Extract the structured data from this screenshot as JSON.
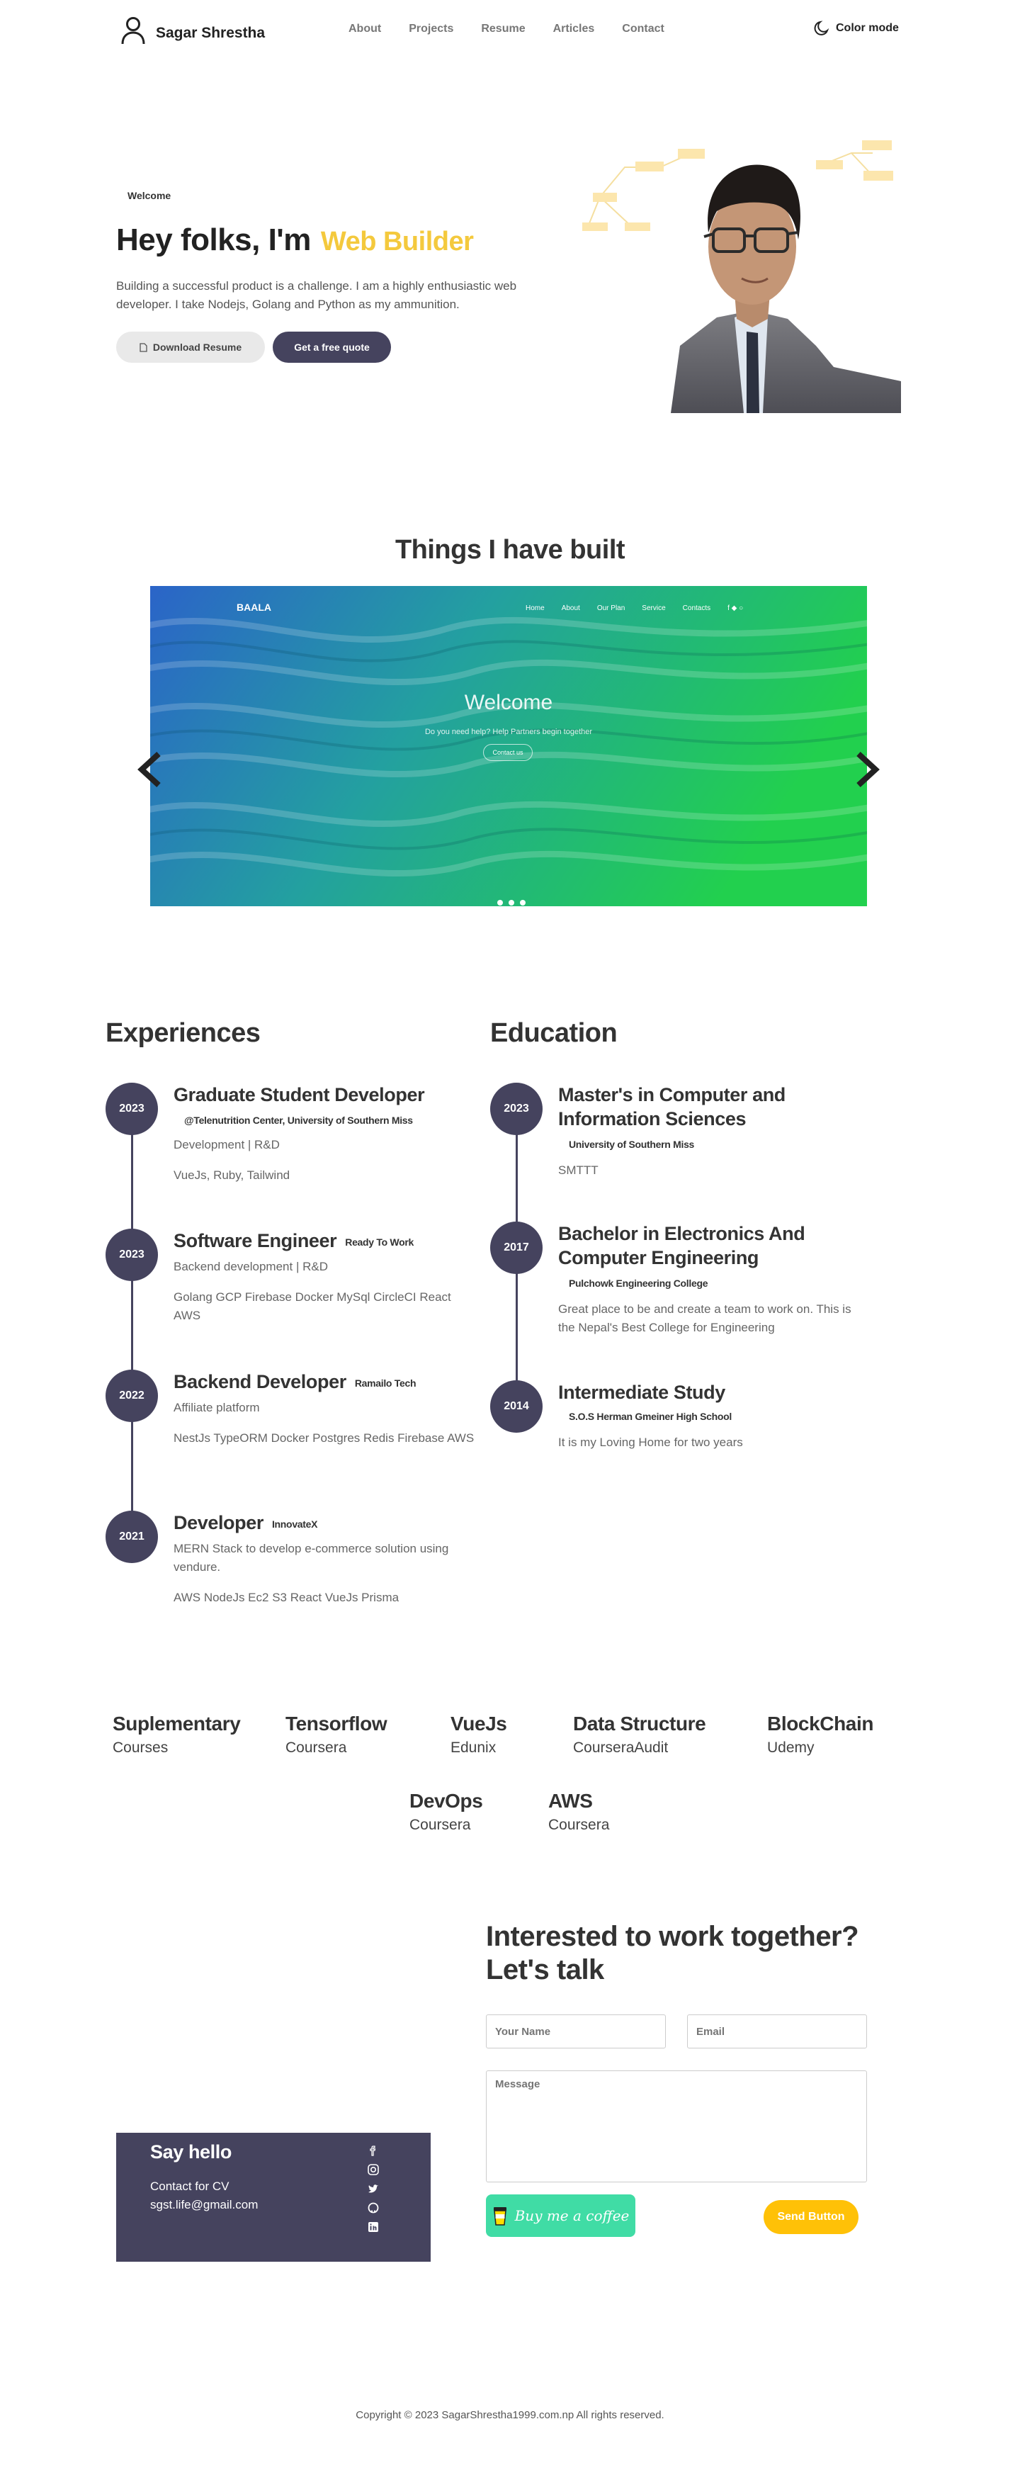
{
  "header": {
    "brand_name": "Sagar Shrestha",
    "nav": [
      "About",
      "Projects",
      "Resume",
      "Articles",
      "Contact"
    ],
    "color_mode_label": "Color mode"
  },
  "hero": {
    "welcome": "Welcome",
    "title": "Hey folks, I'm",
    "title_accent": "Web Builder",
    "description": "Building a successful product is a challenge. I am a highly enthusiastic web developer. I take Nodejs, Golang and Python as my ammunition.",
    "resume_button": "Download Resume",
    "quote_button": "Get a free quote",
    "accent_color": "#f4c93d"
  },
  "projects": {
    "title": "Things I have built",
    "slide": {
      "logo": "BAALA",
      "nav": [
        "Home",
        "About",
        "Our Plan",
        "Service",
        "Contacts"
      ],
      "heading": "Welcome",
      "subtitle": "Do you need help? Help Partners begin together",
      "button": "Contact us"
    }
  },
  "experiences": {
    "title": "Experiences",
    "items": [
      {
        "year": "2023",
        "role": "Graduate Student Developer",
        "org": "@Telenutrition Center, University of Southern Miss",
        "summary": "Development | R&D",
        "stack": "VueJs, Ruby, Tailwind"
      },
      {
        "year": "2023",
        "role": "Software Engineer",
        "org": "Ready To Work",
        "summary": "Backend development | R&D",
        "stack": "Golang GCP Firebase Docker MySql CircleCI React AWS"
      },
      {
        "year": "2022",
        "role": "Backend Developer",
        "org": "Ramailo Tech",
        "summary": "Affiliate platform",
        "stack": "NestJs TypeORM Docker Postgres Redis Firebase AWS"
      },
      {
        "year": "2021",
        "role": "Developer",
        "org": "InnovateX",
        "summary": "MERN Stack to develop e-commerce solution using vendure.",
        "stack": "AWS NodeJs Ec2 S3 React VueJs Prisma"
      }
    ]
  },
  "education": {
    "title": "Education",
    "items": [
      {
        "year": "2023",
        "degree": "Master's in Computer and Information Sciences",
        "school": "University of Southern Miss",
        "note": "SMTTT"
      },
      {
        "year": "2017",
        "degree": "Bachelor in Electronics And Computer Engineering",
        "school": "Pulchowk Engineering College",
        "note": "Great place to be and create a team to work on. This is the Nepal's Best College for Engineering"
      },
      {
        "year": "2014",
        "degree": "Intermediate Study",
        "school": "S.O.S Herman Gmeiner High School",
        "note": "It is my Loving Home for two years"
      }
    ]
  },
  "courses": [
    {
      "name": "Suplementary",
      "source": "Courses"
    },
    {
      "name": "Tensorflow",
      "source": "Coursera"
    },
    {
      "name": "VueJs",
      "source": "Edunix"
    },
    {
      "name": "Data Structure",
      "source": "CourseraAudit"
    },
    {
      "name": "BlockChain",
      "source": "Udemy"
    },
    {
      "name": "DevOps",
      "source": "Coursera"
    },
    {
      "name": "AWS",
      "source": "Coursera"
    }
  ],
  "contact": {
    "title": "Interested to work together? Let's talk",
    "name_placeholder": "Your Name",
    "email_placeholder": "Email",
    "message_placeholder": "Message",
    "coffee_label": "Buy me a coffee",
    "send_label": "Send Button",
    "hello": {
      "title": "Say hello",
      "line1": "Contact for CV",
      "email": "sgst.life@gmail.com",
      "social_icons": [
        "facebook-icon",
        "instagram-icon",
        "twitter-icon",
        "github-icon",
        "linkedin-icon"
      ]
    }
  },
  "footer": {
    "copyright": "Copyright © 2023 SagarShrestha1999.com.np All rights reserved."
  },
  "colors": {
    "primary": "#45435e",
    "accent": "#f4c93d",
    "coffee": "#40dca5",
    "send": "#ffc107"
  }
}
